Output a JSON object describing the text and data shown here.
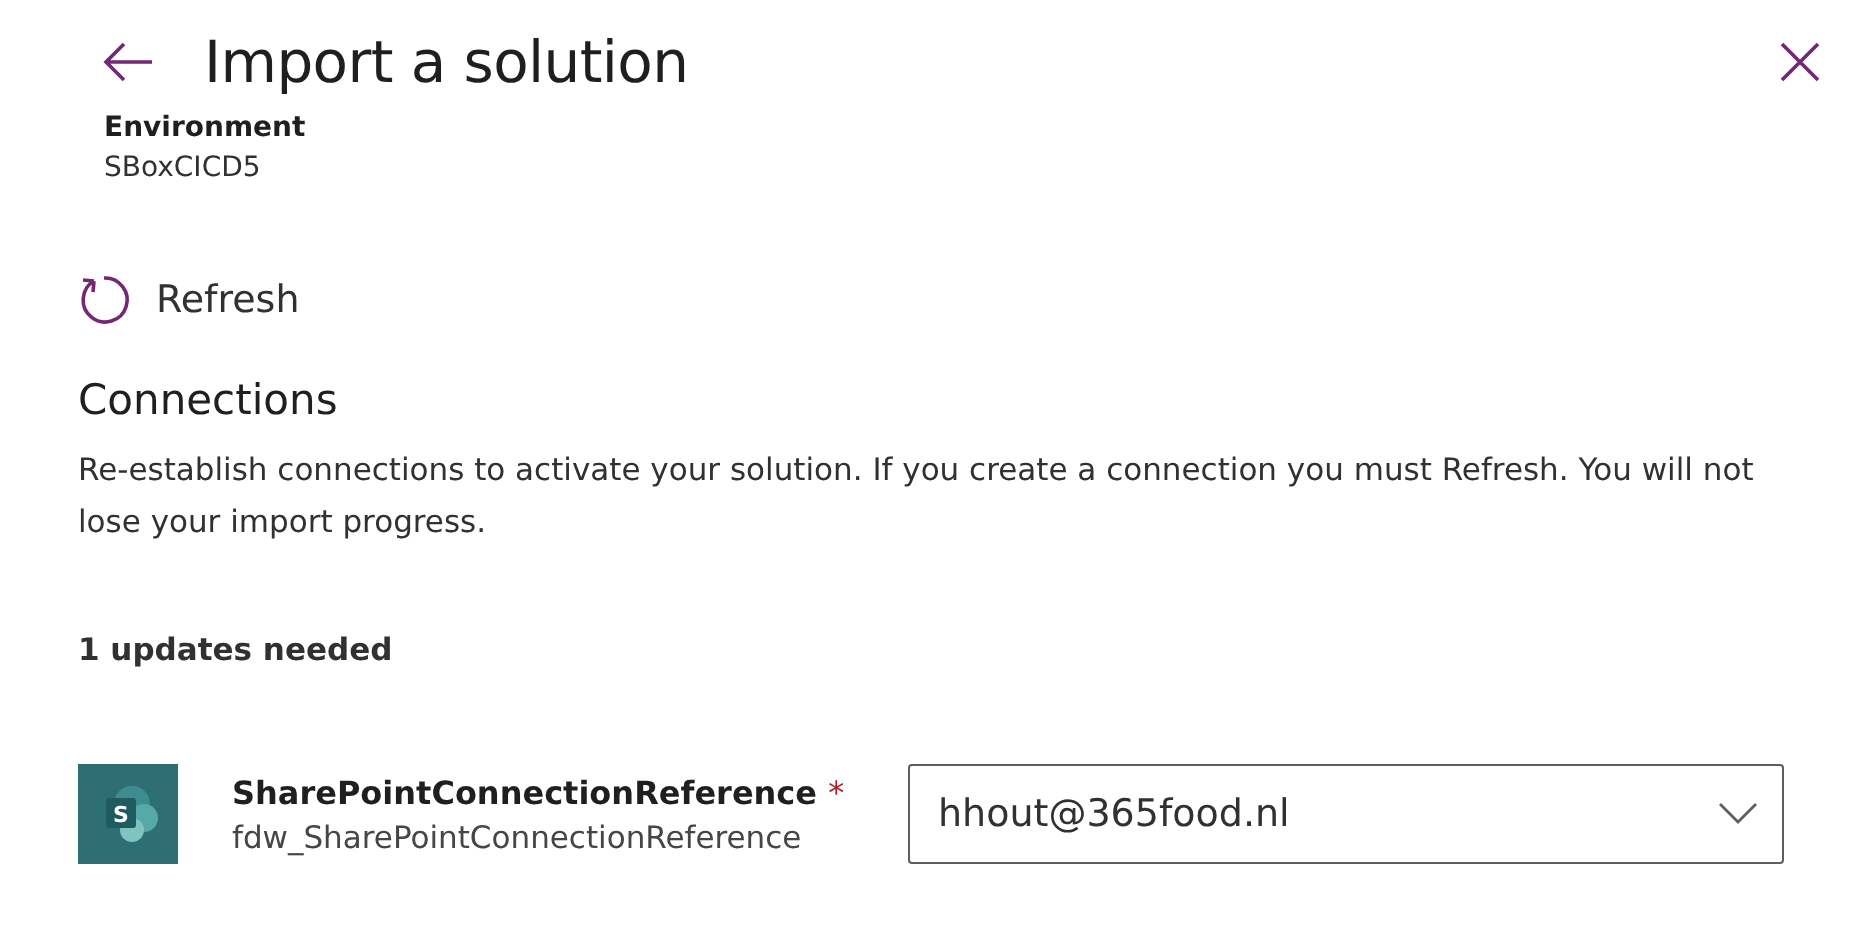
{
  "header": {
    "title": "Import a solution",
    "environment_label": "Environment",
    "environment_value": "SBoxCICD5"
  },
  "refresh": {
    "label": "Refresh"
  },
  "connections": {
    "heading": "Connections",
    "description": "Re-establish connections to activate your solution. If you create a connection you must Refresh. You will not lose your import progress.",
    "updates_needed": "1 updates needed",
    "items": [
      {
        "name": "SharePointConnectionReference",
        "required": true,
        "required_mark": "*",
        "logical_name": "fdw_SharePointConnectionReference",
        "icon_letter": "S",
        "selected_connection": "hhout@365food.nl"
      }
    ]
  }
}
